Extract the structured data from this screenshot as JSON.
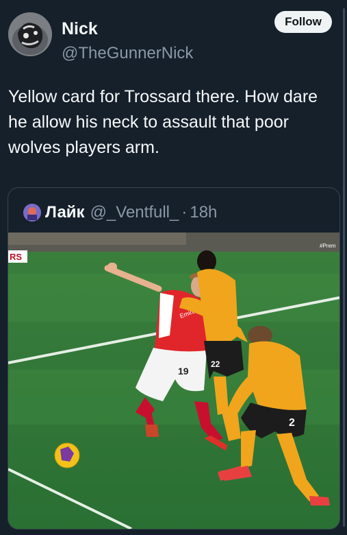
{
  "author": {
    "name": "Nick",
    "handle": "@TheGunnerNick",
    "follow_label": "Follow"
  },
  "tweet": {
    "text": "Yellow card for Trossard there. How dare he allow his neck to assault that poor wolves players arm."
  },
  "quoted": {
    "name": "Лайк",
    "handle": "@_Ventfull_",
    "separator": "·",
    "time": "18h",
    "media": {
      "overlay_left": "RS",
      "overlay_right": "#Prem",
      "jersey_numbers": [
        "19",
        "22",
        "2"
      ],
      "sponsor": "Emirates"
    }
  },
  "colors": {
    "background": "#15202b",
    "text": "#f7f9f9",
    "muted": "#8b98a5",
    "border": "#38444d",
    "pitch": "#2f7a3a"
  }
}
